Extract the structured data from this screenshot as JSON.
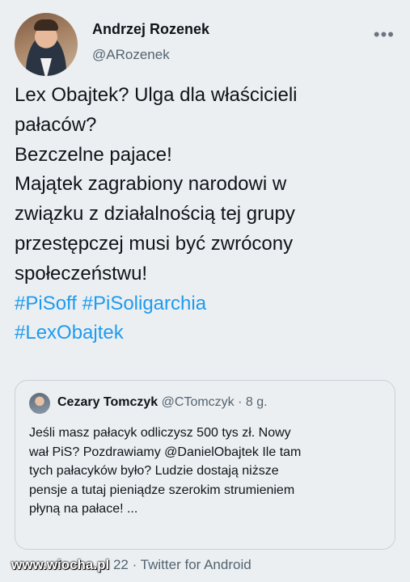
{
  "author": {
    "name": "Andrzej Rozenek",
    "handle": "@ARozenek"
  },
  "tweet": {
    "lines": [
      "Lex Obajtek? Ulga dla właścicieli",
      "pałaców?",
      "Bezczelne pajace!",
      "Majątek zagrabiony narodowi w",
      "związku z działalnością tej grupy",
      "przestępczej musi być zwrócony",
      "społeczeństwu!"
    ],
    "hashtags": [
      "#PiSoff",
      "#PiSoligarchia",
      "#LexObajtek"
    ]
  },
  "quote": {
    "name": "Cezary Tomczyk",
    "handle": "@CTomczyk",
    "time": "· 8 g.",
    "lines": [
      "Jeśli masz pałacyk odliczysz 500 tys zł. Nowy",
      "wał PiS? Pozdrawiamy @DanielObajtek Ile tam",
      "tych pałacyków było? Ludzie dostają niższe",
      "pensje a tutaj pieniądze szerokim strumieniem",
      "płyną na pałace! ..."
    ]
  },
  "footer": {
    "watermark": "www.wiocha.pl",
    "date_tail": "22",
    "source": "· Twitter for Android"
  },
  "colors": {
    "background": "#eceff1",
    "text": "#0f1419",
    "muted": "#536471",
    "hashtag": "#1d9bf0",
    "border": "#c9d0d6"
  },
  "icons": {
    "more": "more-dots-icon"
  }
}
